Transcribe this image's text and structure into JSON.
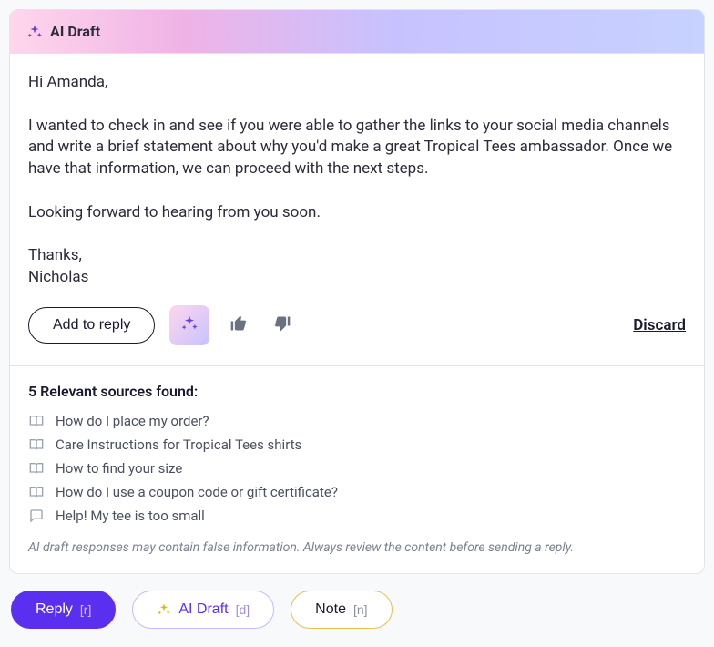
{
  "header": {
    "title": "AI Draft"
  },
  "draft": {
    "body": "Hi Amanda,\n\nI wanted to check in and see if you were able to gather the links to your social media channels and write a brief statement about why you'd make a great Tropical Tees ambassador. Once we have that information, we can proceed with the next steps.\n\nLooking forward to hearing from you soon.\n\nThanks,\nNicholas"
  },
  "actions": {
    "add_to_reply": "Add to reply",
    "discard": "Discard"
  },
  "sources": {
    "title": "5 Relevant sources found:",
    "items": [
      {
        "icon": "book",
        "label": "How do I place my order?"
      },
      {
        "icon": "book",
        "label": "Care Instructions for Tropical Tees shirts"
      },
      {
        "icon": "book",
        "label": "How to find your size"
      },
      {
        "icon": "book",
        "label": "How do I use a coupon code or gift certificate?"
      },
      {
        "icon": "chat",
        "label": "Help! My tee is too small"
      }
    ]
  },
  "disclaimer": "AI draft responses may contain false information. Always review the content before sending a reply.",
  "bottom": {
    "reply": {
      "label": "Reply",
      "shortcut": "[r]"
    },
    "ai_draft": {
      "label": "AI Draft",
      "shortcut": "[d]"
    },
    "note": {
      "label": "Note",
      "shortcut": "[n]"
    }
  }
}
